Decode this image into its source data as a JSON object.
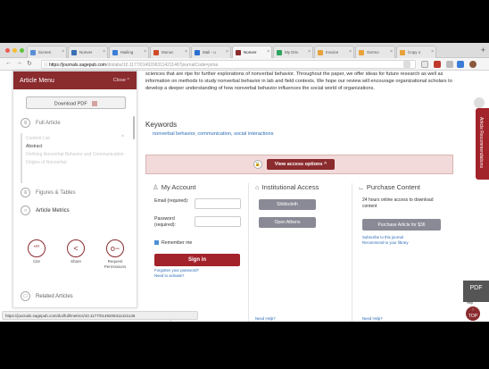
{
  "browser": {
    "tabs": [
      {
        "label": "Screen",
        "color": "#5a8fd6"
      },
      {
        "label": "Nonver",
        "color": "#3b6fb6"
      },
      {
        "label": "Mailing",
        "color": "#3b7dd8"
      },
      {
        "label": "Monoc",
        "color": "#d04a2a"
      },
      {
        "label": "Mail - u",
        "color": "#2b6fd0"
      },
      {
        "label": "Nonver",
        "color": "#8a2b2e"
      },
      {
        "label": "My Driv",
        "color": "#2fa360"
      },
      {
        "label": "Invoice",
        "color": "#e8a23a"
      },
      {
        "label": "Germo",
        "color": "#e8a23a"
      },
      {
        "label": "Copy o",
        "color": "#e8a23a"
      }
    ],
    "url_host": "https://journals.sagepub.com",
    "url_path": "/doi/abs/10.1177/0149206311421146?journalCode=joma",
    "status_url": "https://journals.sagepub.com/doi/full/metrics/10.1177/0149206311421146"
  },
  "menu": {
    "title": "Article Menu",
    "close_label": "Close ^",
    "download_pdf": "Download PDF",
    "full_article": "Full Article",
    "toc_title": "Content List",
    "toc_items": [
      "Abstract",
      "Defining Nonverbal Behavior and Communication",
      "Origins of Nonverbal"
    ],
    "figures_tables": "Figures & Tables",
    "article_metrics": "Article Metrics",
    "tools": [
      {
        "label": "Cite",
        "symbol": "“”"
      },
      {
        "label": "Share",
        "symbol": "<"
      },
      {
        "label": "Request Permissions",
        "symbol": "o−"
      }
    ],
    "related_articles": "Related Articles"
  },
  "article": {
    "intro": "sciences that are ripe for further explorations of nonverbal behavior. Throughout the paper, we offer ideas for future research as well as information on methods to study nonverbal behavior in lab and field contexts. We hope our review will encourage organizational scholars to develop a deeper understanding of how nonverbal behavior influences the social world of organizations.",
    "keywords_title": "Keywords",
    "keywords": "nonverbal behavior, communication, social interactions",
    "view_access": "View access options ^"
  },
  "account": {
    "title": "My Account",
    "email_label": "Email (required):",
    "password_label": "Password (required):",
    "remember_me": "Remember me",
    "signin": "Sign in",
    "forgot": "Forgotten your password?",
    "activate": "Need to activate?",
    "need_help": "Need Help?"
  },
  "institutional": {
    "title": "Institutional Access",
    "shibboleth": "Shibboleth",
    "open_athens": "Open Athens",
    "need_help": "Need Help?"
  },
  "purchase": {
    "title": "Purchase Content",
    "access_text": "24 hours online access to download content",
    "button": "Purchase Article for $36",
    "subscribe": "Subscribe to this journal",
    "recommend": "Recommend to your library",
    "need_help": "Need Help?"
  },
  "side": {
    "feedback": "Article Recommendations",
    "pdf": "PDF",
    "help": "Help",
    "top": "TOP"
  },
  "colors": {
    "brand": "#8a2b2e",
    "signin": "#a3232a",
    "link": "#2a6bb5",
    "access_bar": "#f3dada"
  }
}
